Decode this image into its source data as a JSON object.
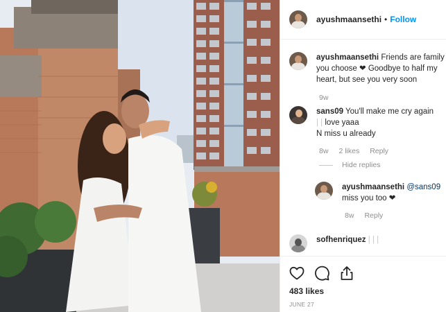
{
  "post": {
    "author": "ayushmaansethi",
    "separator": "•",
    "follow_label": "Follow"
  },
  "comments": [
    {
      "username": "ayushmaansethi",
      "text": "Friends are family you choose ❤ Goodbye to half my heart, but see you very soon",
      "time": "9w"
    },
    {
      "username": "sans09",
      "text_line1": "You'll make me cry again",
      "text_line2": "love yaaa",
      "text_line3": "N miss u already",
      "time": "8w",
      "likes": "2 likes",
      "reply_label": "Reply",
      "hide_replies": "Hide replies"
    },
    {
      "username": "ayushmaansethi",
      "mention": "@sans09",
      "text": "miss you too ❤",
      "time": "8w",
      "reply_label": "Reply"
    },
    {
      "username": "sofhenriquez",
      "text": ""
    }
  ],
  "actions": {
    "icons": [
      "heart-icon",
      "comment-icon",
      "share-icon"
    ],
    "likes": "483 likes",
    "date": "JUNE 27"
  },
  "colors": {
    "link_blue": "#0095f6",
    "mention_blue": "#00376b",
    "muted_gray": "#8e8e8e",
    "border": "#efefef"
  }
}
